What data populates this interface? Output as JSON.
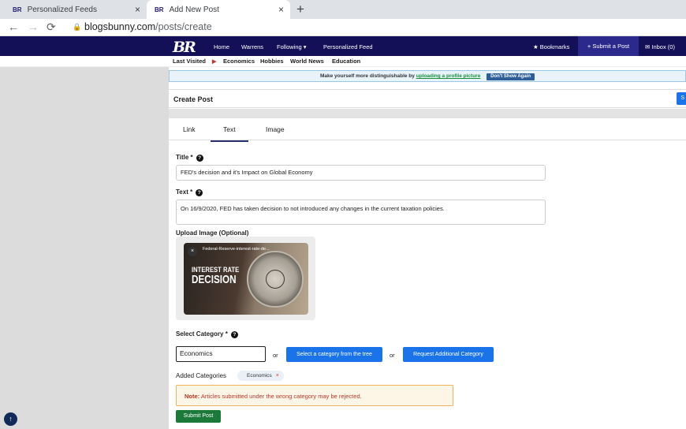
{
  "browser": {
    "tabs": [
      {
        "favicon": "BR",
        "title": "Personalized Feeds",
        "close": "×"
      },
      {
        "favicon": "BR",
        "title": "Add New Post",
        "close": "×"
      }
    ],
    "new_tab": "+",
    "url_host": "blogsbunny.com",
    "url_path": "/posts/create"
  },
  "navbar": {
    "logo": "BR",
    "links": [
      "Home",
      "Warrens",
      "Following ▾",
      "Personalized Feed"
    ],
    "bookmarks": "★ Bookmarks",
    "submit": "+ Submit a Post",
    "inbox": "✉ Inbox (0)"
  },
  "subnav": {
    "last_visited": "Last Visited",
    "arrow": "▶",
    "items": [
      "Economics",
      "Hobbies",
      "World News",
      "Education"
    ]
  },
  "banner": {
    "text": "Make yourself more distinguishable by",
    "link": "uploading a profile picture",
    "button": "Don't Show Again"
  },
  "create": {
    "title": "Create Post",
    "side_button": "S"
  },
  "tabs": [
    "Link",
    "Text",
    "Image"
  ],
  "form": {
    "title_label": "Title *",
    "title_value": "FED's decision and it's Impact on Global Economy",
    "text_label": "Text *",
    "text_value": "On 16/9/2020, FED has taken decision to not introduced any changes in the current taxation policies.",
    "upload_label": "Upload Image (Optional)",
    "image_caption": "Federal-Reserve-interest-rate-de...",
    "image_line1": "INTEREST RATE",
    "image_line2": "DECISION",
    "category_label": "Select Category *",
    "category_value": "Economics",
    "or": "or",
    "tree_button": "Select a category from the tree",
    "request_button": "Request Additional Category",
    "added_label": "Added Categories",
    "chip": "Economics",
    "chip_remove": "×",
    "note_bold": "Note:",
    "note_text": " Articles submitted under the wrong category may be rejected.",
    "submit": "Submit Post"
  },
  "help_icon": "?",
  "scroll_top_icon": "↑",
  "image_close": "×"
}
